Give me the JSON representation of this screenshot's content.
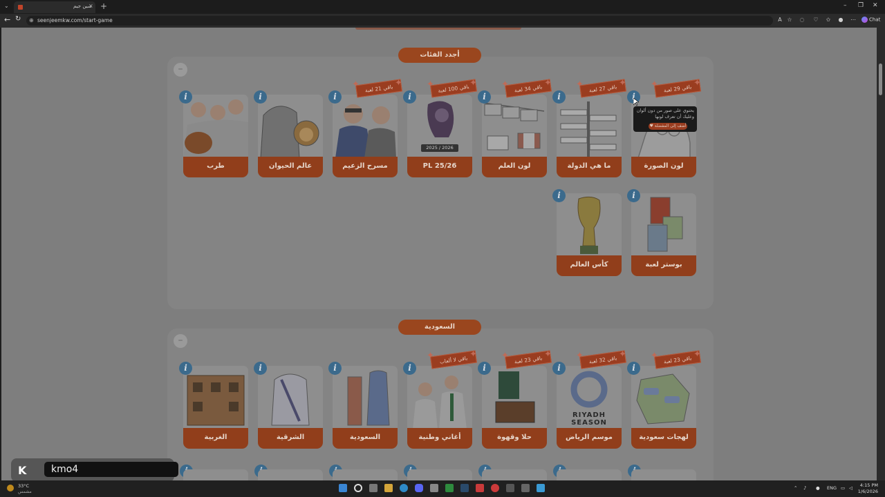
{
  "browser": {
    "tab_title": "سين جيم",
    "url": "seenjeemkw.com/start-game",
    "chat_label": "Chat"
  },
  "sections": {
    "newest": {
      "title": "أجدد الفئات",
      "cards": [
        {
          "label": "لون الصورة",
          "badge": "باقي 29 لعبة"
        },
        {
          "label": "ما هي الدولة",
          "badge": "باقي 27 لعبة"
        },
        {
          "label": "لون العلم",
          "badge": "باقي 34 لعبة"
        },
        {
          "label": "PL 25/26",
          "badge": "باقي 100 لعبة"
        },
        {
          "label": "مسرح الزعيم",
          "badge": "باقي 21 لعبة"
        },
        {
          "label": "عالم الحيوان",
          "badge": ""
        },
        {
          "label": "طرب",
          "badge": ""
        },
        {
          "label": "بوستر لعبة",
          "badge": ""
        },
        {
          "label": "كأس العالم",
          "badge": ""
        }
      ]
    },
    "saudi": {
      "title": "السعودية",
      "cards": [
        {
          "label": "لهجات سعودية",
          "badge": "باقي 23 لعبة"
        },
        {
          "label": "موسم الرياض",
          "badge": "باقي 32 لعبة"
        },
        {
          "label": "حلا وقهوة",
          "badge": "باقي 23 لعبة"
        },
        {
          "label": "أغاني وطنية",
          "badge": "باقي لا ألعاب"
        },
        {
          "label": "السعودية",
          "badge": ""
        },
        {
          "label": "الشرقية",
          "badge": ""
        },
        {
          "label": "الغربية",
          "badge": ""
        }
      ]
    }
  },
  "tooltip": {
    "text_line1": "يحتوي على صور من دون ألوان",
    "text_line2": "وعليك أن تعرف لونها",
    "button": "أضف إلى المفضلة"
  },
  "pl_badge_text": "2025 / 2026",
  "riyadh_text": "RIYADH SEASON",
  "taskbar": {
    "temp": "33°C",
    "condition": "مشمس",
    "lang": "ENG",
    "time": "4:15 PM",
    "date": "1/6/2026"
  },
  "overlay": {
    "username": "kmo4"
  },
  "colors": {
    "accent": "#9a461e",
    "page_dimmed": "#7e7e7e",
    "info": "#3b6a8c"
  }
}
